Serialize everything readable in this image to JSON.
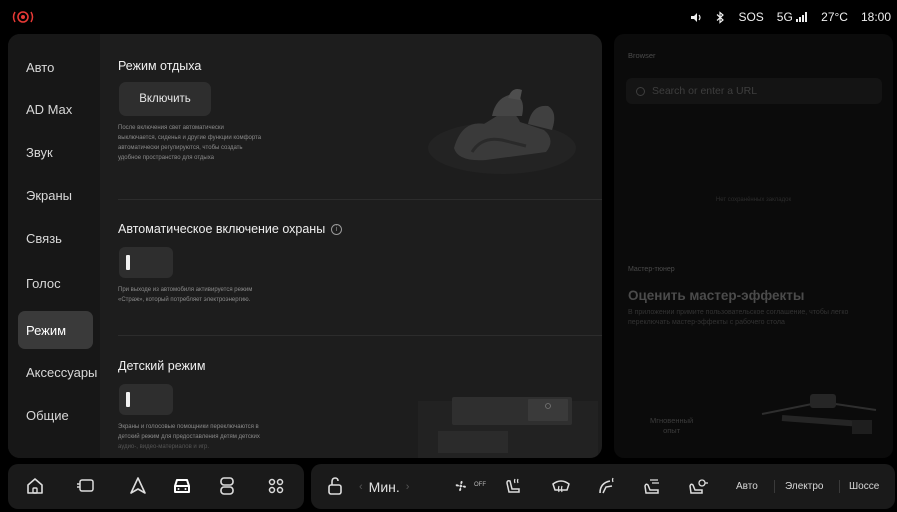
{
  "status_bar": {
    "volume_icon": "speaker-icon",
    "bluetooth_icon": "bluetooth-icon",
    "sos": "SOS",
    "network": "5G",
    "signal_icon": "signal-icon",
    "temperature": "27°C",
    "time": "18:00"
  },
  "sidebar": {
    "items": [
      {
        "label": "Авто",
        "active": false
      },
      {
        "label": "AD Max",
        "active": false
      },
      {
        "label": "Звук",
        "active": false
      },
      {
        "label": "Экраны",
        "active": false
      },
      {
        "label": "Связь",
        "active": false
      },
      {
        "label": "Голос",
        "active": false
      },
      {
        "label": "Режим",
        "active": true
      },
      {
        "label": "Аксессуары",
        "active": false
      },
      {
        "label": "Общие",
        "active": false
      }
    ]
  },
  "rest_mode": {
    "title": "Режим отдыха",
    "button": "Включить",
    "description": [
      "После включения свет автоматически",
      "выключается, сиденья и другие функции комфорта",
      "автоматически регулируются, чтобы создать",
      "удобное пространство для отдыха"
    ]
  },
  "auto_guard": {
    "title": "Автоматическое включение охраны",
    "info_icon": "info-icon",
    "toggle_on": true,
    "description": [
      "При выходе из автомобиля активируется режим",
      "«Страж», который потребляет электроэнергию."
    ]
  },
  "kids_mode": {
    "title": "Детский режим",
    "toggle_on": true,
    "description": [
      "Экраны и голосовые помощники переключаются в",
      "детский режим для предоставления детям детских",
      "аудио-, видео-материалов и игр."
    ]
  },
  "right_panel": {
    "browser_label": "Browser",
    "url_placeholder": "Search or enter a URL",
    "faint_text": "Нет сохранённых закладок",
    "tuner_label": "Мастер-тюнер",
    "tuner_title": "Оценить мастер-эффекты",
    "tuner_desc": "В приложении примите пользовательское соглашение, чтобы легко переключать мастер-эффекты с рабочего стола",
    "instant_label": [
      "Мгновенный",
      "опыт"
    ]
  },
  "dock": {
    "left_icons": [
      "home-icon",
      "window-icon",
      "navigation-icon",
      "car-icon",
      "media-icon",
      "apps-icon"
    ],
    "lock_icon": "lock-icon",
    "climate_value": "Мин.",
    "fan_off": "OFF",
    "right_icons": [
      "fan-icon",
      "seat-heat-icon",
      "defrost-icon",
      "steering-heat-icon",
      "seat-vent-icon",
      "seat-massage-icon"
    ],
    "modes": [
      "Авто",
      "Электро",
      "Шоссе"
    ]
  },
  "colors": {
    "background": "#000000",
    "panel": "#1d1d1d",
    "sidebar_active": "#3a3a3a",
    "alert_red": "#e53935"
  }
}
